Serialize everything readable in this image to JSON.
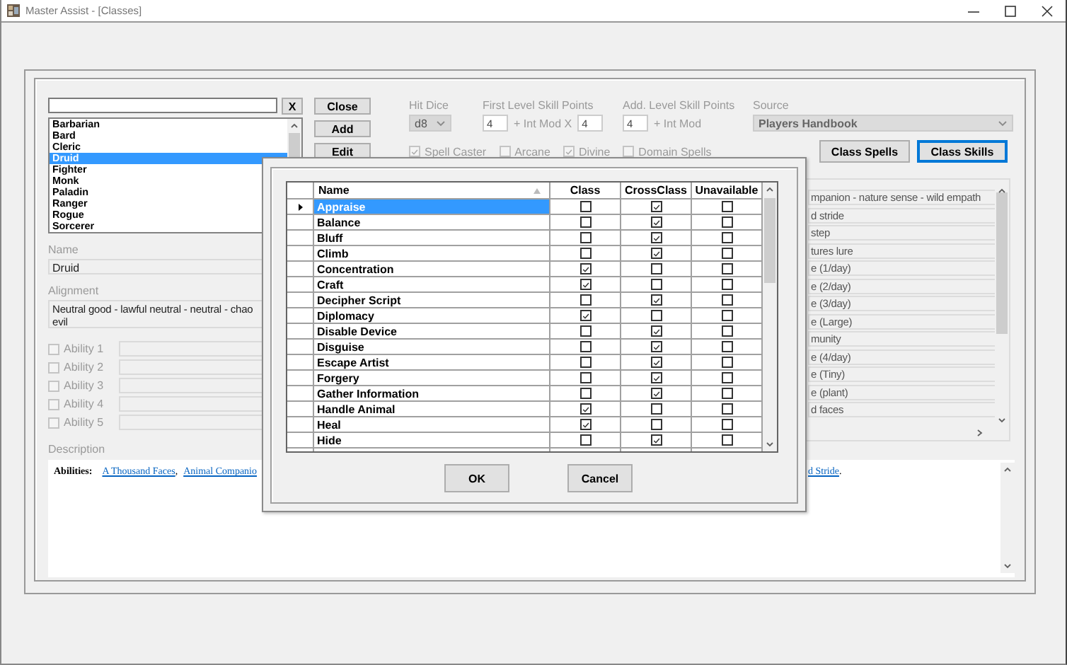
{
  "window": {
    "title": "Master Assist - [Classes]"
  },
  "class_search": {
    "clear_button": "X"
  },
  "class_list": [
    {
      "label": "Barbarian",
      "selected": false
    },
    {
      "label": "Bard",
      "selected": false
    },
    {
      "label": "Cleric",
      "selected": false
    },
    {
      "label": "Druid",
      "selected": true
    },
    {
      "label": "Fighter",
      "selected": false
    },
    {
      "label": "Monk",
      "selected": false
    },
    {
      "label": "Paladin",
      "selected": false
    },
    {
      "label": "Ranger",
      "selected": false
    },
    {
      "label": "Rogue",
      "selected": false
    },
    {
      "label": "Sorcerer",
      "selected": false
    }
  ],
  "buttons": [
    "Close",
    "Add",
    "Edit"
  ],
  "name": {
    "label": "Name",
    "value": "Druid"
  },
  "alignment": {
    "label": "Alignment",
    "lines": [
      "Neutral good - lawful neutral - neutral - chao",
      "evil"
    ]
  },
  "ability_scores": [
    {
      "label": "Ability 1",
      "checked": false,
      "disabled": true
    },
    {
      "label": "Ability 2",
      "checked": false,
      "disabled": true
    },
    {
      "label": "Ability 3",
      "checked": false,
      "disabled": true
    },
    {
      "label": "Ability 4",
      "checked": false,
      "disabled": true
    },
    {
      "label": "Ability 5",
      "checked": false,
      "disabled": true
    }
  ],
  "hit_dice": {
    "label": "Hit Dice",
    "value": "d8"
  },
  "first_level_skill_points": {
    "label": "First Level Skill Points",
    "value": "4",
    "suffix": "+ Int Mod X",
    "multiplier": "4"
  },
  "add_level_skill_points": {
    "label": "Add. Level Skill Points",
    "value": "4",
    "suffix": "+ Int Mod"
  },
  "source": {
    "label": "Source",
    "value": "Players Handbook"
  },
  "flags": [
    {
      "label": "Spell Caster",
      "checked": true,
      "disabled": true
    },
    {
      "label": "Arcane",
      "checked": false,
      "disabled": true
    },
    {
      "label": "Divine",
      "checked": true,
      "disabled": true
    },
    {
      "label": "Domain Spells",
      "checked": false,
      "disabled": true
    }
  ],
  "class_buttons": [
    {
      "label": "Class Spells",
      "selected": false
    },
    {
      "label": "Class Skills",
      "selected": true
    }
  ],
  "abilities_list": [
    "mpanion - nature sense - wild empath",
    "d stride",
    "step",
    "tures lure",
    "e (1/day)",
    "e (2/day)",
    "e (3/day)",
    "e (Large)",
    "munity",
    "e (4/day)",
    "e (Tiny)",
    "e (plant)",
    "d faces"
  ],
  "description": {
    "label": "Description",
    "left_parts": [
      {
        "kind": "text",
        "text": "Abilities:"
      },
      {
        "kind": "link",
        "text": "A Thousand Faces"
      },
      {
        "kind": "text",
        "text": ","
      },
      {
        "kind": "link",
        "text": "Animal Companio"
      }
    ],
    "right_parts": [
      {
        "kind": "link",
        "text": "d Stride"
      },
      {
        "kind": "text",
        "text": "."
      }
    ]
  },
  "skills_dialog": {
    "columns": [
      "Name",
      "Class",
      "CrossClass",
      "Unavailable"
    ],
    "rows": [
      {
        "name": "Appraise",
        "selected": true,
        "class": false,
        "cross_class": true,
        "unavailable": false
      },
      {
        "name": "Balance",
        "selected": false,
        "class": false,
        "cross_class": true,
        "unavailable": false
      },
      {
        "name": "Bluff",
        "selected": false,
        "class": false,
        "cross_class": true,
        "unavailable": false
      },
      {
        "name": "Climb",
        "selected": false,
        "class": false,
        "cross_class": true,
        "unavailable": false
      },
      {
        "name": "Concentration",
        "selected": false,
        "class": true,
        "cross_class": false,
        "unavailable": false
      },
      {
        "name": "Craft",
        "selected": false,
        "class": true,
        "cross_class": false,
        "unavailable": false
      },
      {
        "name": "Decipher Script",
        "selected": false,
        "class": false,
        "cross_class": true,
        "unavailable": false
      },
      {
        "name": "Diplomacy",
        "selected": false,
        "class": true,
        "cross_class": false,
        "unavailable": false
      },
      {
        "name": "Disable Device",
        "selected": false,
        "class": false,
        "cross_class": true,
        "unavailable": false
      },
      {
        "name": "Disguise",
        "selected": false,
        "class": false,
        "cross_class": true,
        "unavailable": false
      },
      {
        "name": "Escape Artist",
        "selected": false,
        "class": false,
        "cross_class": true,
        "unavailable": false
      },
      {
        "name": "Forgery",
        "selected": false,
        "class": false,
        "cross_class": true,
        "unavailable": false
      },
      {
        "name": "Gather Information",
        "selected": false,
        "class": false,
        "cross_class": true,
        "unavailable": false
      },
      {
        "name": "Handle Animal",
        "selected": false,
        "class": true,
        "cross_class": false,
        "unavailable": false
      },
      {
        "name": "Heal",
        "selected": false,
        "class": true,
        "cross_class": false,
        "unavailable": false
      },
      {
        "name": "Hide",
        "selected": false,
        "class": false,
        "cross_class": true,
        "unavailable": false
      }
    ],
    "buttons": [
      "OK",
      "Cancel"
    ]
  }
}
